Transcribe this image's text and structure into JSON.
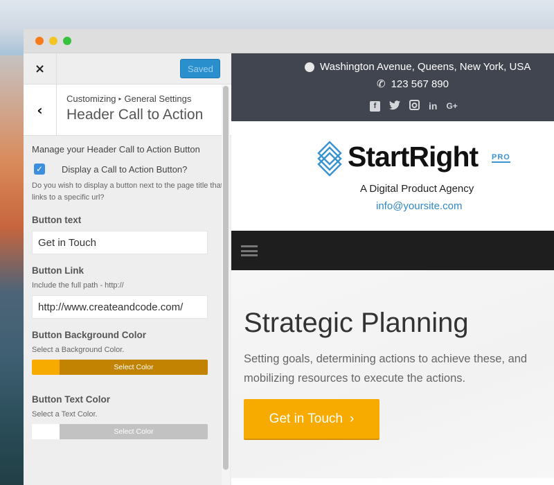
{
  "window": {
    "traffic_lights": [
      "close",
      "minimize",
      "maximize"
    ]
  },
  "customizer": {
    "close_icon": "×",
    "saved_label": "Saved",
    "back_icon": "‹",
    "breadcrumb": {
      "root": "Customizing",
      "separator_icon": "▸",
      "parent": "General Settings"
    },
    "section_title": "Header Call to Action",
    "manage_title": "Manage your Header Call to Action Button",
    "display_cta": {
      "checked": true,
      "check_icon": "✓",
      "label": "Display a Call to Action Button?",
      "description": "Do you wish to display a button next to the page title that links to a specific url?"
    },
    "button_text": {
      "title": "Button text",
      "value": "Get in Touch"
    },
    "button_link": {
      "title": "Button Link",
      "description": "Include the full path - http://",
      "value": "http://www.createandcode.com/"
    },
    "button_bg_color": {
      "title": "Button Background Color",
      "description": "Select a Background Color.",
      "button_label": "Select Color",
      "swatch_color": "#f7aa00",
      "button_color": "#c28202"
    },
    "button_text_color": {
      "title": "Button Text Color",
      "description": "Select a Text Color.",
      "button_label": "Select Color",
      "swatch_color": "#ffffff",
      "button_color": "#c2c2c2"
    }
  },
  "preview": {
    "topbar": {
      "address": "Washington Avenue, Queens, New York, USA",
      "phone": "123 567 890",
      "phone_icon": "✆",
      "socials": [
        {
          "name": "facebook",
          "glyph": "f"
        },
        {
          "name": "twitter",
          "glyph": "🐦"
        },
        {
          "name": "instagram",
          "glyph": "◙"
        },
        {
          "name": "linkedin",
          "glyph": "in"
        },
        {
          "name": "google-plus",
          "glyph": "G+"
        }
      ]
    },
    "brand": {
      "name": "StartRight",
      "badge": "PRO",
      "tagline": "A Digital Product Agency",
      "email": "info@yoursite.com",
      "accent": "#3a93d1"
    },
    "hero": {
      "title": "Strategic Planning",
      "text": "Setting goals, determining actions to achieve these, and mobilizing resources to execute the actions.",
      "cta_label": "Get in Touch",
      "cta_icon": "›",
      "cta_color": "#f7aa00"
    }
  }
}
